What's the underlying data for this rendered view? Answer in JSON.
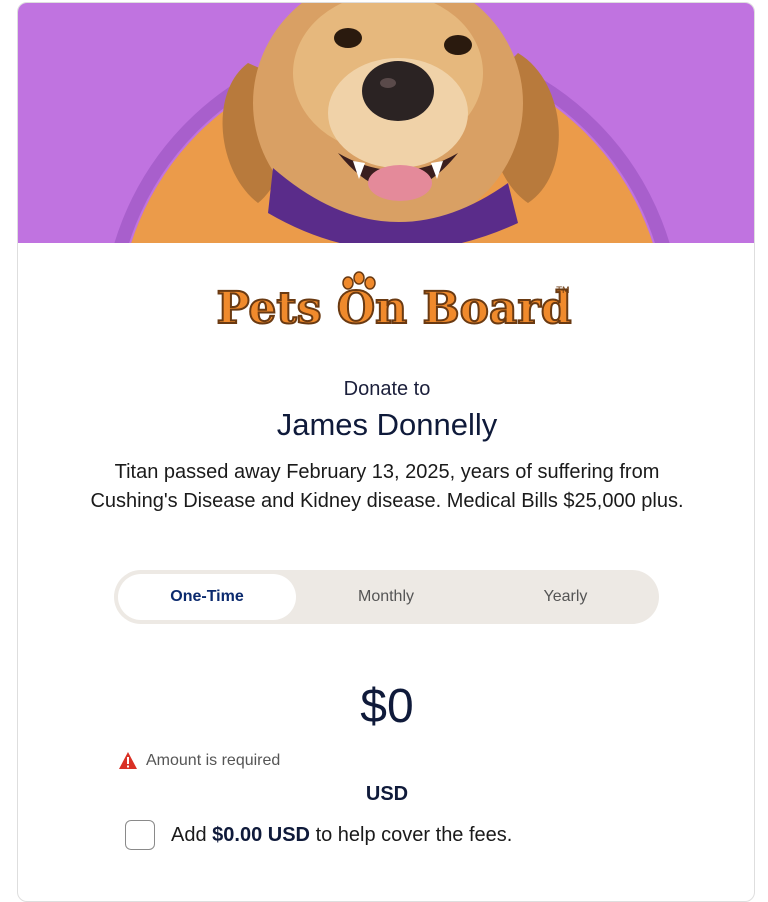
{
  "logo": {
    "text": "Pets On Board",
    "trademark": "TM"
  },
  "donation": {
    "intro": "Donate to",
    "recipient": "James Donnelly",
    "description": "Titan passed away February 13, 2025, years of suffering from Cushing's Disease and Kidney disease. Medical Bills $25,000 plus."
  },
  "frequency": {
    "tabs": [
      {
        "label": "One-Time",
        "selected": true
      },
      {
        "label": "Monthly",
        "selected": false
      },
      {
        "label": "Yearly",
        "selected": false
      }
    ]
  },
  "amount": {
    "value": "$0",
    "error": "Amount is required",
    "currency": "USD"
  },
  "fees": {
    "prefix": "Add",
    "amount": "$0.00 USD",
    "suffix": "to help cover the fees.",
    "checked": false
  },
  "colors": {
    "banner_purple": "#c073e0",
    "banner_orange": "#eb9b4a",
    "logo_orange": "#f08a2c",
    "selected_tab_text": "#0b2a6e",
    "heading_navy": "#0f1a3a",
    "error_red": "#d93025"
  },
  "icons": [
    "dog-photo",
    "paw-icon",
    "warning-icon",
    "checkbox"
  ]
}
